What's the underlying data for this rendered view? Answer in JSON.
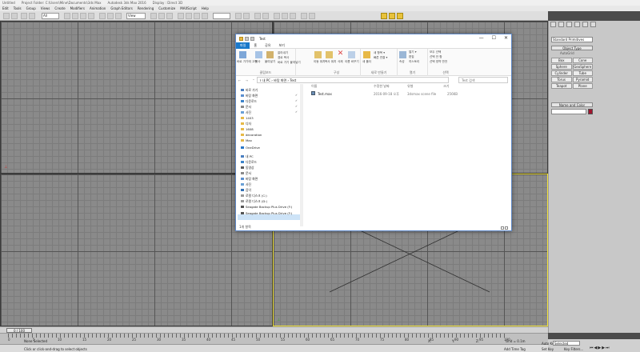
{
  "app": {
    "title_parts": [
      "Untitled",
      "Project Folder: C:\\Users\\Mine\\Documents\\3ds Max",
      "Autodesk 3ds Max 2016",
      "Display : Direct 3D"
    ]
  },
  "menu": [
    "Edit",
    "Tools",
    "Group",
    "Views",
    "Create",
    "Modifiers",
    "Animation",
    "Graph Editors",
    "Rendering",
    "Customize",
    "MAXScript",
    "Help"
  ],
  "toolbar": {
    "view_select": "All",
    "ref_select": "View"
  },
  "command_panel": {
    "category_select": "Standard Primitives",
    "object_type_header": "Object Type",
    "autogrid": "AutoGrid",
    "buttons": [
      "Box",
      "Cone",
      "Sphere",
      "GeoSphere",
      "Cylinder",
      "Tube",
      "Torus",
      "Pyramid",
      "Teapot",
      "Plane"
    ],
    "name_color_header": "Name and Color"
  },
  "timeline": {
    "slider_label": "0 / 100",
    "ticks": [
      "0",
      "5",
      "10",
      "15",
      "20",
      "25",
      "30",
      "35",
      "40",
      "45",
      "50",
      "55",
      "60",
      "65",
      "70",
      "75",
      "80",
      "85",
      "90",
      "95",
      "100"
    ]
  },
  "status": {
    "selection": "None Selected",
    "prompt": "Click or click-and-drag to select objects",
    "coords": [
      "X:",
      "Y:",
      "Z:"
    ],
    "grid": "Grid = 0.1m",
    "add_time_tag": "Add Time Tag",
    "auto_key": "Auto Key",
    "set_key": "Set Key",
    "key_mode_select": "Selected",
    "key_filters": "Key Filters..."
  },
  "explorer": {
    "title": "Test",
    "window_buttons": [
      "—",
      "☐",
      "✕"
    ],
    "tabs": [
      "파일",
      "홈",
      "공유",
      "보기"
    ],
    "ribbon": {
      "clipboard": {
        "label": "클립보드",
        "items": [
          "바로 가기에 고정",
          "복사",
          "붙여넣기",
          "잘라내기",
          "경로 복사",
          "바로 가기 붙여넣기"
        ]
      },
      "organize": {
        "label": "구성",
        "items": [
          "이동 위치",
          "복사 위치",
          "삭제",
          "이름 바꾸기"
        ]
      },
      "new": {
        "label": "새로 만들기",
        "items": [
          "새 폴더",
          "새 항목 ▾",
          "빠른 연결 ▾"
        ]
      },
      "open": {
        "label": "열기",
        "items": [
          "속성",
          "열기 ▾",
          "편집",
          "히스토리"
        ]
      },
      "select": {
        "label": "선택",
        "items": [
          "모두 선택",
          "선택 안 함",
          "선택 영역 반전"
        ]
      }
    },
    "nav_arrows": "← → ⌃ ↑",
    "address": "› 내 PC › 바탕 화면 › Test",
    "search_placeholder": "Test 검색",
    "nav_items": [
      {
        "label": "바로 가기",
        "pin": ""
      },
      {
        "label": "바탕 화면",
        "pin": "✔"
      },
      {
        "label": "다운로드",
        "pin": "✔"
      },
      {
        "label": "문서",
        "pin": "✔"
      },
      {
        "label": "사진",
        "pin": "✔"
      },
      {
        "label": "1403",
        "pin": ""
      },
      {
        "label": "디자",
        "pin": ""
      },
      {
        "label": "1608",
        "pin": ""
      },
      {
        "label": "decoration",
        "pin": ""
      },
      {
        "label": "Max",
        "pin": ""
      },
      {
        "label": "OneDrive",
        "pin": ""
      },
      {
        "label": "내 PC",
        "pin": ""
      },
      {
        "label": "다운로드",
        "pin": ""
      },
      {
        "label": "동영상",
        "pin": ""
      },
      {
        "label": "문서",
        "pin": ""
      },
      {
        "label": "바탕 화면",
        "pin": ""
      },
      {
        "label": "사진",
        "pin": ""
      },
      {
        "label": "음악",
        "pin": ""
      },
      {
        "label": "로컬 디스크 (C:)",
        "pin": ""
      },
      {
        "label": "로컬 디스크 (D:)",
        "pin": ""
      },
      {
        "label": "Seagate Backup Plus Drive (F:)",
        "pin": ""
      },
      {
        "label": "Seagate Backup Plus Drive (F:)",
        "pin": ""
      }
    ],
    "columns": [
      "이름",
      "수정한 날짜",
      "유형",
      "크기"
    ],
    "files": [
      {
        "name": "Test.max",
        "date": "2016-09-18 오후",
        "type": "3dsmax scene file",
        "size": "256KB"
      }
    ],
    "status": "1개 항목"
  }
}
